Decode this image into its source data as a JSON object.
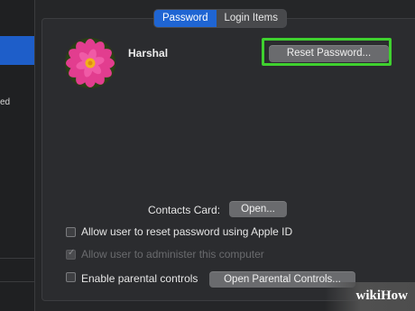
{
  "tabs": [
    {
      "label": "Password",
      "active": true
    },
    {
      "label": "Login Items",
      "active": false
    }
  ],
  "sidebar": {
    "partial_text": "ed"
  },
  "user": {
    "name": "Harshal"
  },
  "buttons": {
    "reset_password": "Reset Password...",
    "open": "Open...",
    "open_parental_controls": "Open Parental Controls..."
  },
  "contacts_card_label": "Contacts Card:",
  "checkboxes": [
    {
      "label": "Allow user to reset password using Apple ID",
      "checked": false,
      "enabled": true
    },
    {
      "label": "Allow user to administer this computer",
      "checked": true,
      "enabled": false
    },
    {
      "label": "Enable parental controls",
      "checked": false,
      "enabled": true
    }
  ],
  "watermark": "wikiHow",
  "colors": {
    "accent_tab": "#1f65d3",
    "highlight_border": "#3fd12f",
    "background": "#252628"
  }
}
